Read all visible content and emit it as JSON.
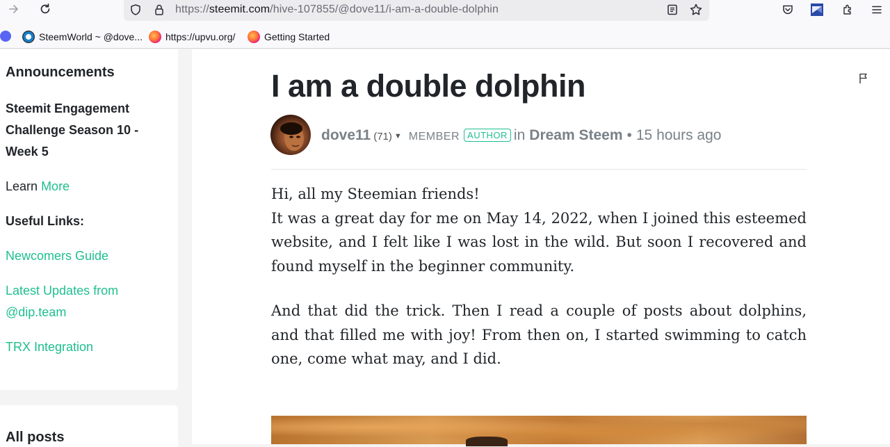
{
  "browser": {
    "url_prefix": "https://",
    "url_domain": "steemit.com",
    "url_path": "/hive-107855/@dove11/i-am-a-double-dolphin"
  },
  "bookmarks": [
    {
      "label": "SteemWorld ~ @dove..."
    },
    {
      "label": "https://upvu.org/"
    },
    {
      "label": "Getting Started"
    }
  ],
  "sidebar": {
    "announcements_heading": "Announcements",
    "challenge_line1": "Steemit Engagement",
    "challenge_line2": "Challenge Season 10 -",
    "challenge_line3": "Week 5",
    "learn_text": "Learn",
    "learn_more": "More",
    "useful_links_heading": "Useful Links:",
    "links": [
      {
        "label": "Newcomers Guide"
      },
      {
        "label": "Latest Updates from"
      },
      {
        "label": "@dip.team"
      },
      {
        "label": "TRX Integration"
      }
    ],
    "all_posts_heading": "All posts"
  },
  "post": {
    "title": "I am a double dolphin",
    "author": "dove11",
    "reputation": "(71)",
    "role": "MEMBER",
    "badge": "AUTHOR",
    "in_word": "in",
    "community": "Dream Steem",
    "separator": "•",
    "time_ago": "15 hours ago",
    "paragraph1_line1": "Hi, all my Steemian friends!",
    "paragraph1_rest": "It was a great day for me on May 14, 2022, when I joined this esteemed website, and I felt like I was lost in the wild. But soon I recovered and found myself in the beginner community.",
    "paragraph2": "And that did the trick. Then I read a couple of posts about dolphins, and that filled me with joy! From then on, I started swimming to catch one, come what may, and I did."
  },
  "icons": {
    "forward": "arrow-right-icon",
    "reload": "reload-icon",
    "shield": "shield-icon",
    "lock": "lock-icon",
    "reader": "reader-view-icon",
    "bookmark_star": "star-icon",
    "pocket": "pocket-icon",
    "extension": "extension-icon",
    "menu": "hamburger-menu-icon",
    "flag": "flag-icon"
  },
  "colors": {
    "link": "#1fbf8f",
    "text": "#212529",
    "muted": "#788187"
  }
}
